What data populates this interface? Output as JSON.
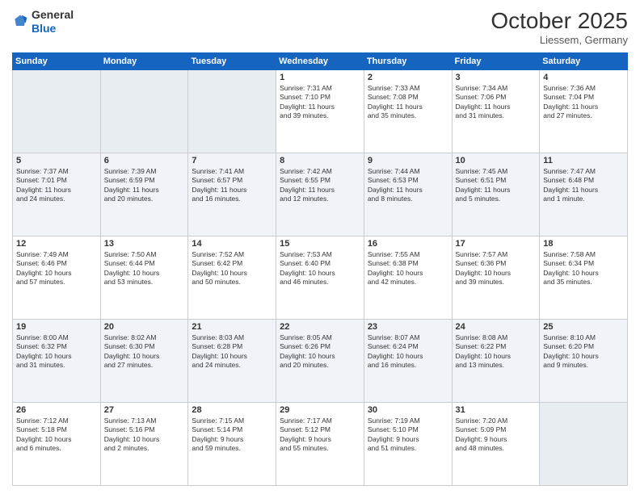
{
  "header": {
    "logo_general": "General",
    "logo_blue": "Blue",
    "month": "October 2025",
    "location": "Liessem, Germany"
  },
  "days_of_week": [
    "Sunday",
    "Monday",
    "Tuesday",
    "Wednesday",
    "Thursday",
    "Friday",
    "Saturday"
  ],
  "weeks": [
    [
      {
        "num": "",
        "empty": true
      },
      {
        "num": "",
        "empty": true
      },
      {
        "num": "",
        "empty": true
      },
      {
        "num": "1",
        "line1": "Sunrise: 7:31 AM",
        "line2": "Sunset: 7:10 PM",
        "line3": "Daylight: 11 hours",
        "line4": "and 39 minutes."
      },
      {
        "num": "2",
        "line1": "Sunrise: 7:33 AM",
        "line2": "Sunset: 7:08 PM",
        "line3": "Daylight: 11 hours",
        "line4": "and 35 minutes."
      },
      {
        "num": "3",
        "line1": "Sunrise: 7:34 AM",
        "line2": "Sunset: 7:06 PM",
        "line3": "Daylight: 11 hours",
        "line4": "and 31 minutes."
      },
      {
        "num": "4",
        "line1": "Sunrise: 7:36 AM",
        "line2": "Sunset: 7:04 PM",
        "line3": "Daylight: 11 hours",
        "line4": "and 27 minutes."
      }
    ],
    [
      {
        "num": "5",
        "line1": "Sunrise: 7:37 AM",
        "line2": "Sunset: 7:01 PM",
        "line3": "Daylight: 11 hours",
        "line4": "and 24 minutes."
      },
      {
        "num": "6",
        "line1": "Sunrise: 7:39 AM",
        "line2": "Sunset: 6:59 PM",
        "line3": "Daylight: 11 hours",
        "line4": "and 20 minutes."
      },
      {
        "num": "7",
        "line1": "Sunrise: 7:41 AM",
        "line2": "Sunset: 6:57 PM",
        "line3": "Daylight: 11 hours",
        "line4": "and 16 minutes."
      },
      {
        "num": "8",
        "line1": "Sunrise: 7:42 AM",
        "line2": "Sunset: 6:55 PM",
        "line3": "Daylight: 11 hours",
        "line4": "and 12 minutes."
      },
      {
        "num": "9",
        "line1": "Sunrise: 7:44 AM",
        "line2": "Sunset: 6:53 PM",
        "line3": "Daylight: 11 hours",
        "line4": "and 8 minutes."
      },
      {
        "num": "10",
        "line1": "Sunrise: 7:45 AM",
        "line2": "Sunset: 6:51 PM",
        "line3": "Daylight: 11 hours",
        "line4": "and 5 minutes."
      },
      {
        "num": "11",
        "line1": "Sunrise: 7:47 AM",
        "line2": "Sunset: 6:48 PM",
        "line3": "Daylight: 11 hours",
        "line4": "and 1 minute."
      }
    ],
    [
      {
        "num": "12",
        "line1": "Sunrise: 7:49 AM",
        "line2": "Sunset: 6:46 PM",
        "line3": "Daylight: 10 hours",
        "line4": "and 57 minutes."
      },
      {
        "num": "13",
        "line1": "Sunrise: 7:50 AM",
        "line2": "Sunset: 6:44 PM",
        "line3": "Daylight: 10 hours",
        "line4": "and 53 minutes."
      },
      {
        "num": "14",
        "line1": "Sunrise: 7:52 AM",
        "line2": "Sunset: 6:42 PM",
        "line3": "Daylight: 10 hours",
        "line4": "and 50 minutes."
      },
      {
        "num": "15",
        "line1": "Sunrise: 7:53 AM",
        "line2": "Sunset: 6:40 PM",
        "line3": "Daylight: 10 hours",
        "line4": "and 46 minutes."
      },
      {
        "num": "16",
        "line1": "Sunrise: 7:55 AM",
        "line2": "Sunset: 6:38 PM",
        "line3": "Daylight: 10 hours",
        "line4": "and 42 minutes."
      },
      {
        "num": "17",
        "line1": "Sunrise: 7:57 AM",
        "line2": "Sunset: 6:36 PM",
        "line3": "Daylight: 10 hours",
        "line4": "and 39 minutes."
      },
      {
        "num": "18",
        "line1": "Sunrise: 7:58 AM",
        "line2": "Sunset: 6:34 PM",
        "line3": "Daylight: 10 hours",
        "line4": "and 35 minutes."
      }
    ],
    [
      {
        "num": "19",
        "line1": "Sunrise: 8:00 AM",
        "line2": "Sunset: 6:32 PM",
        "line3": "Daylight: 10 hours",
        "line4": "and 31 minutes."
      },
      {
        "num": "20",
        "line1": "Sunrise: 8:02 AM",
        "line2": "Sunset: 6:30 PM",
        "line3": "Daylight: 10 hours",
        "line4": "and 27 minutes."
      },
      {
        "num": "21",
        "line1": "Sunrise: 8:03 AM",
        "line2": "Sunset: 6:28 PM",
        "line3": "Daylight: 10 hours",
        "line4": "and 24 minutes."
      },
      {
        "num": "22",
        "line1": "Sunrise: 8:05 AM",
        "line2": "Sunset: 6:26 PM",
        "line3": "Daylight: 10 hours",
        "line4": "and 20 minutes."
      },
      {
        "num": "23",
        "line1": "Sunrise: 8:07 AM",
        "line2": "Sunset: 6:24 PM",
        "line3": "Daylight: 10 hours",
        "line4": "and 16 minutes."
      },
      {
        "num": "24",
        "line1": "Sunrise: 8:08 AM",
        "line2": "Sunset: 6:22 PM",
        "line3": "Daylight: 10 hours",
        "line4": "and 13 minutes."
      },
      {
        "num": "25",
        "line1": "Sunrise: 8:10 AM",
        "line2": "Sunset: 6:20 PM",
        "line3": "Daylight: 10 hours",
        "line4": "and 9 minutes."
      }
    ],
    [
      {
        "num": "26",
        "line1": "Sunrise: 7:12 AM",
        "line2": "Sunset: 5:18 PM",
        "line3": "Daylight: 10 hours",
        "line4": "and 6 minutes."
      },
      {
        "num": "27",
        "line1": "Sunrise: 7:13 AM",
        "line2": "Sunset: 5:16 PM",
        "line3": "Daylight: 10 hours",
        "line4": "and 2 minutes."
      },
      {
        "num": "28",
        "line1": "Sunrise: 7:15 AM",
        "line2": "Sunset: 5:14 PM",
        "line3": "Daylight: 9 hours",
        "line4": "and 59 minutes."
      },
      {
        "num": "29",
        "line1": "Sunrise: 7:17 AM",
        "line2": "Sunset: 5:12 PM",
        "line3": "Daylight: 9 hours",
        "line4": "and 55 minutes."
      },
      {
        "num": "30",
        "line1": "Sunrise: 7:19 AM",
        "line2": "Sunset: 5:10 PM",
        "line3": "Daylight: 9 hours",
        "line4": "and 51 minutes."
      },
      {
        "num": "31",
        "line1": "Sunrise: 7:20 AM",
        "line2": "Sunset: 5:09 PM",
        "line3": "Daylight: 9 hours",
        "line4": "and 48 minutes."
      },
      {
        "num": "",
        "empty": true
      }
    ]
  ]
}
